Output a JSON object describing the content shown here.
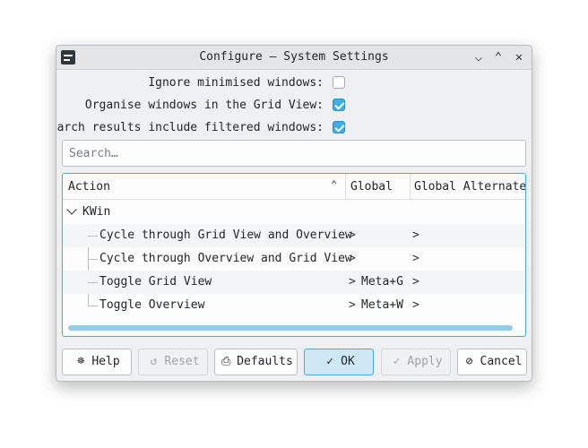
{
  "window": {
    "title": "Configure — System Settings",
    "titlebar_icons": [
      "minimize-icon",
      "maximize-icon",
      "close-icon"
    ]
  },
  "options": [
    {
      "label": "Ignore minimised windows:",
      "checked": false
    },
    {
      "label": "Organise windows in the Grid View:",
      "checked": true
    },
    {
      "label": "Search results include filtered windows:",
      "checked": true
    }
  ],
  "search": {
    "placeholder": "Search…"
  },
  "tree": {
    "columns": [
      "Action",
      "Global",
      "Global Alternate"
    ],
    "group": "KWin",
    "rows": [
      {
        "action": "Cycle through Grid View and Overview",
        "global": "",
        "global_alternate": ""
      },
      {
        "action": "Cycle through Overview and Grid View",
        "global": "",
        "global_alternate": ""
      },
      {
        "action": "Toggle Grid View",
        "global": "Meta+G",
        "global_alternate": ""
      },
      {
        "action": "Toggle Overview",
        "global": "Meta+W",
        "global_alternate": ""
      }
    ],
    "expand_glyph": ">"
  },
  "buttons": {
    "help": "Help",
    "reset": "Reset",
    "defaults": "Defaults",
    "ok": "OK",
    "apply": "Apply",
    "cancel": "Cancel"
  },
  "colors": {
    "accent": "#3daee9",
    "window_bg": "#eff0f1",
    "text": "#232629"
  }
}
